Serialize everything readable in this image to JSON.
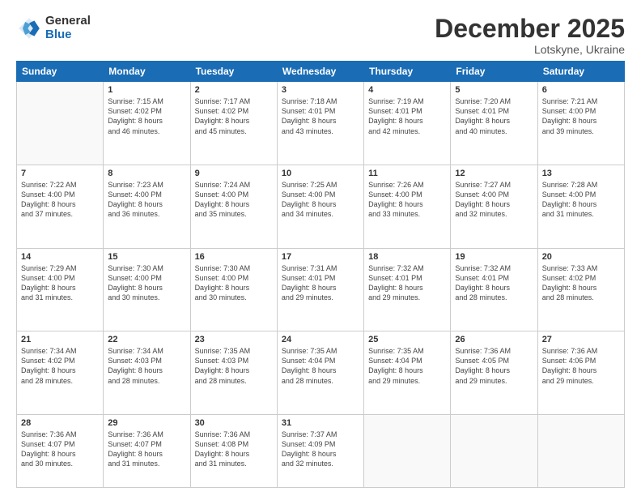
{
  "logo": {
    "general": "General",
    "blue": "Blue"
  },
  "header": {
    "month": "December 2025",
    "location": "Lotskyne, Ukraine"
  },
  "weekdays": [
    "Sunday",
    "Monday",
    "Tuesday",
    "Wednesday",
    "Thursday",
    "Friday",
    "Saturday"
  ],
  "weeks": [
    [
      {
        "day": "",
        "info": ""
      },
      {
        "day": "1",
        "info": "Sunrise: 7:15 AM\nSunset: 4:02 PM\nDaylight: 8 hours\nand 46 minutes."
      },
      {
        "day": "2",
        "info": "Sunrise: 7:17 AM\nSunset: 4:02 PM\nDaylight: 8 hours\nand 45 minutes."
      },
      {
        "day": "3",
        "info": "Sunrise: 7:18 AM\nSunset: 4:01 PM\nDaylight: 8 hours\nand 43 minutes."
      },
      {
        "day": "4",
        "info": "Sunrise: 7:19 AM\nSunset: 4:01 PM\nDaylight: 8 hours\nand 42 minutes."
      },
      {
        "day": "5",
        "info": "Sunrise: 7:20 AM\nSunset: 4:01 PM\nDaylight: 8 hours\nand 40 minutes."
      },
      {
        "day": "6",
        "info": "Sunrise: 7:21 AM\nSunset: 4:00 PM\nDaylight: 8 hours\nand 39 minutes."
      }
    ],
    [
      {
        "day": "7",
        "info": "Sunrise: 7:22 AM\nSunset: 4:00 PM\nDaylight: 8 hours\nand 37 minutes."
      },
      {
        "day": "8",
        "info": "Sunrise: 7:23 AM\nSunset: 4:00 PM\nDaylight: 8 hours\nand 36 minutes."
      },
      {
        "day": "9",
        "info": "Sunrise: 7:24 AM\nSunset: 4:00 PM\nDaylight: 8 hours\nand 35 minutes."
      },
      {
        "day": "10",
        "info": "Sunrise: 7:25 AM\nSunset: 4:00 PM\nDaylight: 8 hours\nand 34 minutes."
      },
      {
        "day": "11",
        "info": "Sunrise: 7:26 AM\nSunset: 4:00 PM\nDaylight: 8 hours\nand 33 minutes."
      },
      {
        "day": "12",
        "info": "Sunrise: 7:27 AM\nSunset: 4:00 PM\nDaylight: 8 hours\nand 32 minutes."
      },
      {
        "day": "13",
        "info": "Sunrise: 7:28 AM\nSunset: 4:00 PM\nDaylight: 8 hours\nand 31 minutes."
      }
    ],
    [
      {
        "day": "14",
        "info": "Sunrise: 7:29 AM\nSunset: 4:00 PM\nDaylight: 8 hours\nand 31 minutes."
      },
      {
        "day": "15",
        "info": "Sunrise: 7:30 AM\nSunset: 4:00 PM\nDaylight: 8 hours\nand 30 minutes."
      },
      {
        "day": "16",
        "info": "Sunrise: 7:30 AM\nSunset: 4:00 PM\nDaylight: 8 hours\nand 30 minutes."
      },
      {
        "day": "17",
        "info": "Sunrise: 7:31 AM\nSunset: 4:01 PM\nDaylight: 8 hours\nand 29 minutes."
      },
      {
        "day": "18",
        "info": "Sunrise: 7:32 AM\nSunset: 4:01 PM\nDaylight: 8 hours\nand 29 minutes."
      },
      {
        "day": "19",
        "info": "Sunrise: 7:32 AM\nSunset: 4:01 PM\nDaylight: 8 hours\nand 28 minutes."
      },
      {
        "day": "20",
        "info": "Sunrise: 7:33 AM\nSunset: 4:02 PM\nDaylight: 8 hours\nand 28 minutes."
      }
    ],
    [
      {
        "day": "21",
        "info": "Sunrise: 7:34 AM\nSunset: 4:02 PM\nDaylight: 8 hours\nand 28 minutes."
      },
      {
        "day": "22",
        "info": "Sunrise: 7:34 AM\nSunset: 4:03 PM\nDaylight: 8 hours\nand 28 minutes."
      },
      {
        "day": "23",
        "info": "Sunrise: 7:35 AM\nSunset: 4:03 PM\nDaylight: 8 hours\nand 28 minutes."
      },
      {
        "day": "24",
        "info": "Sunrise: 7:35 AM\nSunset: 4:04 PM\nDaylight: 8 hours\nand 28 minutes."
      },
      {
        "day": "25",
        "info": "Sunrise: 7:35 AM\nSunset: 4:04 PM\nDaylight: 8 hours\nand 29 minutes."
      },
      {
        "day": "26",
        "info": "Sunrise: 7:36 AM\nSunset: 4:05 PM\nDaylight: 8 hours\nand 29 minutes."
      },
      {
        "day": "27",
        "info": "Sunrise: 7:36 AM\nSunset: 4:06 PM\nDaylight: 8 hours\nand 29 minutes."
      }
    ],
    [
      {
        "day": "28",
        "info": "Sunrise: 7:36 AM\nSunset: 4:07 PM\nDaylight: 8 hours\nand 30 minutes."
      },
      {
        "day": "29",
        "info": "Sunrise: 7:36 AM\nSunset: 4:07 PM\nDaylight: 8 hours\nand 31 minutes."
      },
      {
        "day": "30",
        "info": "Sunrise: 7:36 AM\nSunset: 4:08 PM\nDaylight: 8 hours\nand 31 minutes."
      },
      {
        "day": "31",
        "info": "Sunrise: 7:37 AM\nSunset: 4:09 PM\nDaylight: 8 hours\nand 32 minutes."
      },
      {
        "day": "",
        "info": ""
      },
      {
        "day": "",
        "info": ""
      },
      {
        "day": "",
        "info": ""
      }
    ]
  ]
}
